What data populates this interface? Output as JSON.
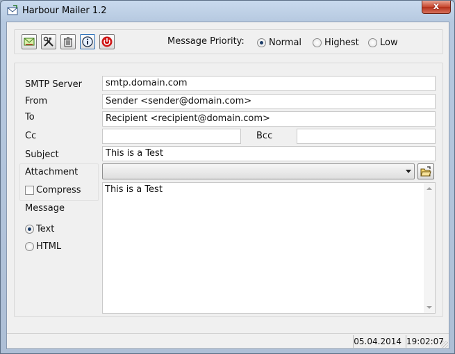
{
  "window": {
    "title": "Harbour Mailer 1.2",
    "close_label": "x"
  },
  "toolbar": {
    "buttons": [
      {
        "icon": "send-mail-icon"
      },
      {
        "icon": "tools-icon"
      },
      {
        "icon": "trash-icon"
      },
      {
        "icon": "info-icon"
      },
      {
        "icon": "power-icon"
      }
    ],
    "priority": {
      "label": "Message Priority:",
      "options": [
        "Normal",
        "Highest",
        "Low"
      ],
      "selected": "Normal"
    }
  },
  "form": {
    "smtp": {
      "label": "SMTP Server",
      "value": "smtp.domain.com"
    },
    "from": {
      "label": "From",
      "value": "Sender <sender@domain.com>"
    },
    "to": {
      "label": "To",
      "value": "Recipient <recipient@domain.com>"
    },
    "cc": {
      "label": "Cc",
      "value": ""
    },
    "bcc": {
      "label": "Bcc",
      "value": ""
    },
    "subject": {
      "label": "Subject",
      "value": "This is a Test"
    },
    "attachment": {
      "label": "Attachment",
      "value": ""
    },
    "compress": {
      "label": "Compress",
      "checked": false
    },
    "message": {
      "label": "Message",
      "formats": [
        "Text",
        "HTML"
      ],
      "selected": "Text",
      "body": "This is a Test"
    }
  },
  "status": {
    "date": "05.04.2014",
    "time": "19:02:07"
  }
}
